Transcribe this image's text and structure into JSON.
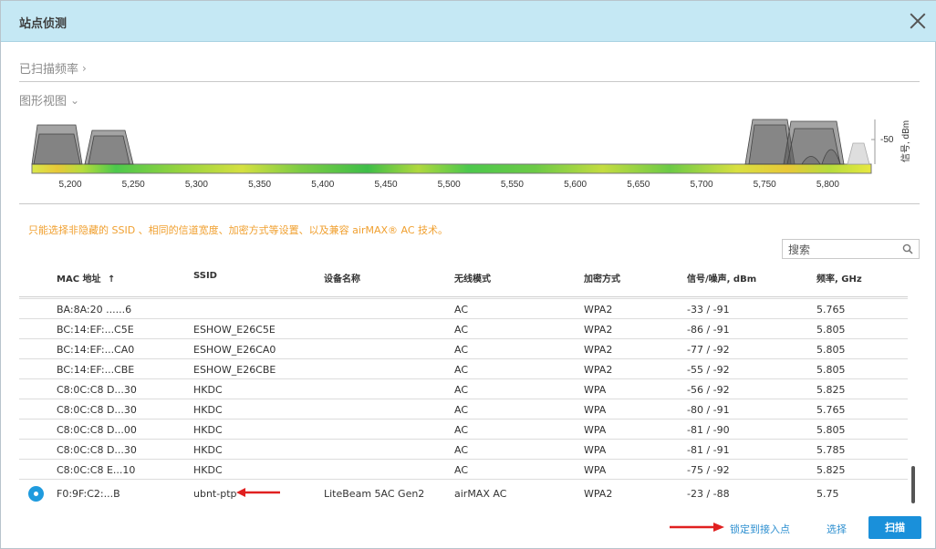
{
  "dialog": {
    "title": "站点侦测",
    "close_icon": "close-icon"
  },
  "sections": {
    "scanned_freq": "已扫描频率",
    "scanned_freq_chevron": "›",
    "graph_view": "图形视图",
    "graph_view_chevron": "⌄"
  },
  "chart_data": {
    "type": "area",
    "x_ticks": [
      "5,200",
      "5,250",
      "5,300",
      "5,350",
      "5,400",
      "5,450",
      "5,500",
      "5,550",
      "5,600",
      "5,650",
      "5,700",
      "5,750",
      "5,800"
    ],
    "y_tick": "-50",
    "ylabel": "信号, dBm",
    "colors": {
      "shape": "#555555",
      "bar_green": "#4cc84c",
      "bar_yellow": "#e6e63c"
    }
  },
  "note": "只能选择非隐藏的 SSID 、相同的信道宽度、加密方式等设置、以及兼容 airMAX® AC 技术。",
  "search": {
    "placeholder": "搜索",
    "icon": "search-icon"
  },
  "table": {
    "headers": {
      "mac": "MAC 地址",
      "sort_icon": "↑",
      "ssid": "SSID",
      "device": "设备名称",
      "mode": "无线模式",
      "security": "加密方式",
      "signal": "信号/噪声, dBm",
      "freq": "频率, GHz"
    },
    "rows": [
      {
        "mac": "BA:8A:20 ......6",
        "ssid": "",
        "device": "",
        "mode": "AC",
        "security": "WPA2",
        "signal": "-33 / -91",
        "freq": "5.765"
      },
      {
        "mac": "BC:14:EF:...C5E",
        "ssid": "ESHOW_E26C5E",
        "device": "",
        "mode": "AC",
        "security": "WPA2",
        "signal": "-86 / -91",
        "freq": "5.805"
      },
      {
        "mac": "BC:14:EF:...CA0",
        "ssid": "ESHOW_E26CA0",
        "device": "",
        "mode": "AC",
        "security": "WPA2",
        "signal": "-77 / -92",
        "freq": "5.805"
      },
      {
        "mac": "BC:14:EF:...CBE",
        "ssid": "ESHOW_E26CBE",
        "device": "",
        "mode": "AC",
        "security": "WPA2",
        "signal": "-55 / -92",
        "freq": "5.805"
      },
      {
        "mac": "C8:0C:C8 D...30",
        "ssid": "HKDC",
        "device": "",
        "mode": "AC",
        "security": "WPA",
        "signal": "-56 / -92",
        "freq": "5.825"
      },
      {
        "mac": "C8:0C:C8 D...30",
        "ssid": "HKDC",
        "device": "",
        "mode": "AC",
        "security": "WPA",
        "signal": "-80 / -91",
        "freq": "5.765"
      },
      {
        "mac": "C8:0C:C8 D...00",
        "ssid": "HKDC",
        "device": "",
        "mode": "AC",
        "security": "WPA",
        "signal": "-81 / -90",
        "freq": "5.805"
      },
      {
        "mac": "C8:0C:C8 D...30",
        "ssid": "HKDC",
        "device": "",
        "mode": "AC",
        "security": "WPA",
        "signal": "-81 / -91",
        "freq": "5.785"
      },
      {
        "mac": "C8:0C:C8 E...10",
        "ssid": "HKDC",
        "device": "",
        "mode": "AC",
        "security": "WPA",
        "signal": "-75 / -92",
        "freq": "5.825"
      },
      {
        "mac": "F0:9F:C2:...B",
        "ssid": "ubnt-ptp",
        "device": "LiteBeam 5AC Gen2",
        "mode": "airMAX AC",
        "security": "WPA2",
        "signal": "-23 / -88",
        "freq": "5.75",
        "selected": true
      }
    ]
  },
  "footer": {
    "lock_ap": "锁定到接入点",
    "select": "选择",
    "scan": "扫描"
  },
  "colors": {
    "accent": "#1a90da",
    "annotation_arrow": "#e02020",
    "titlebar": "#c5e8f4"
  }
}
